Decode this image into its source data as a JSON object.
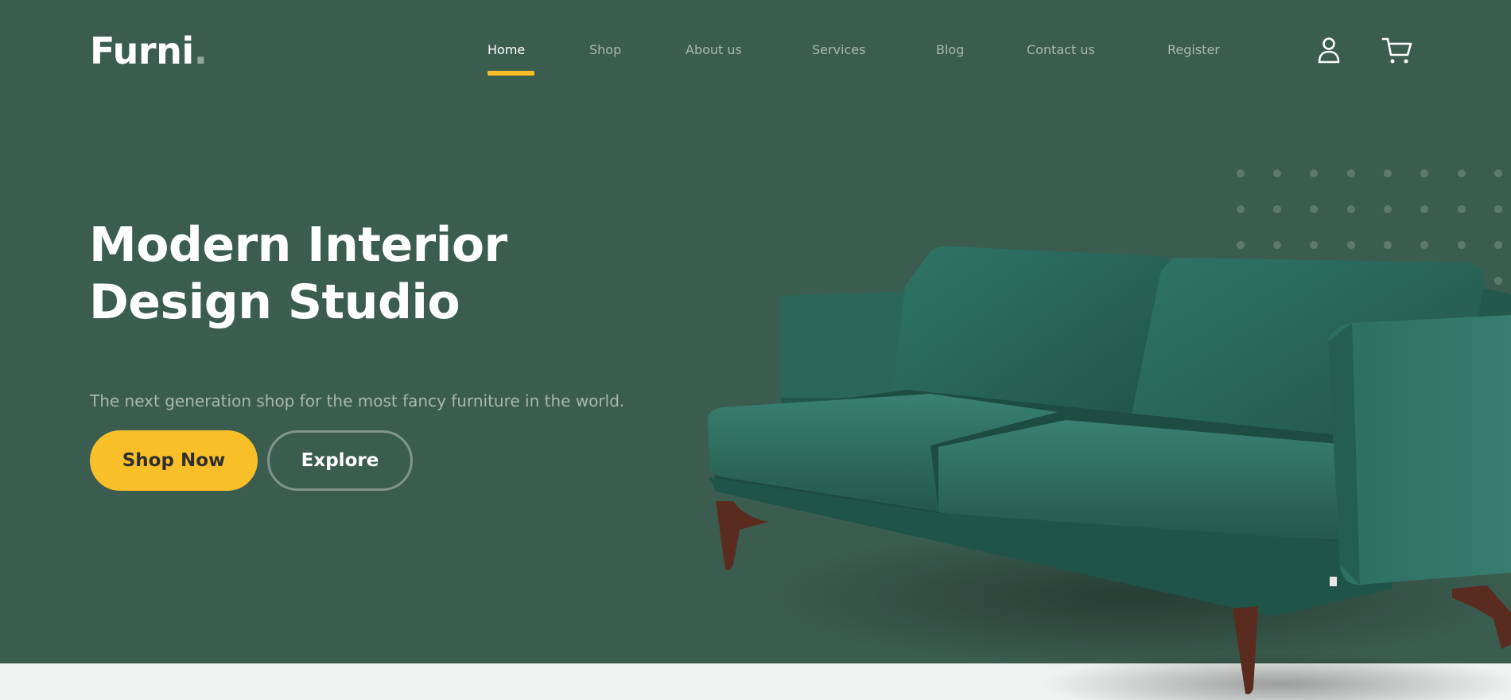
{
  "brand": {
    "name": "Furni",
    "dot": "."
  },
  "nav": {
    "items": [
      {
        "label": "Home",
        "active": true
      },
      {
        "label": "Shop",
        "active": false
      },
      {
        "label": "About us",
        "active": false
      },
      {
        "label": "Services",
        "active": false
      },
      {
        "label": "Blog",
        "active": false
      },
      {
        "label": "Contact us",
        "active": false
      },
      {
        "label": "Register",
        "active": false
      }
    ],
    "icons": [
      "user-icon",
      "cart-icon"
    ]
  },
  "hero": {
    "headline": "Modern Interior Design Studio",
    "subtext": "The next generation shop for the most fancy furniture in the world.",
    "primary_button": "Shop Now",
    "secondary_button": "Explore",
    "image": "green-velvet-sofa"
  },
  "colors": {
    "hero_bg": "#3b5d50",
    "accent": "#f9bf29",
    "page_bg": "#eff2f1",
    "sofa": "#2e6b5c",
    "sofa_legs": "#5a2c20"
  }
}
